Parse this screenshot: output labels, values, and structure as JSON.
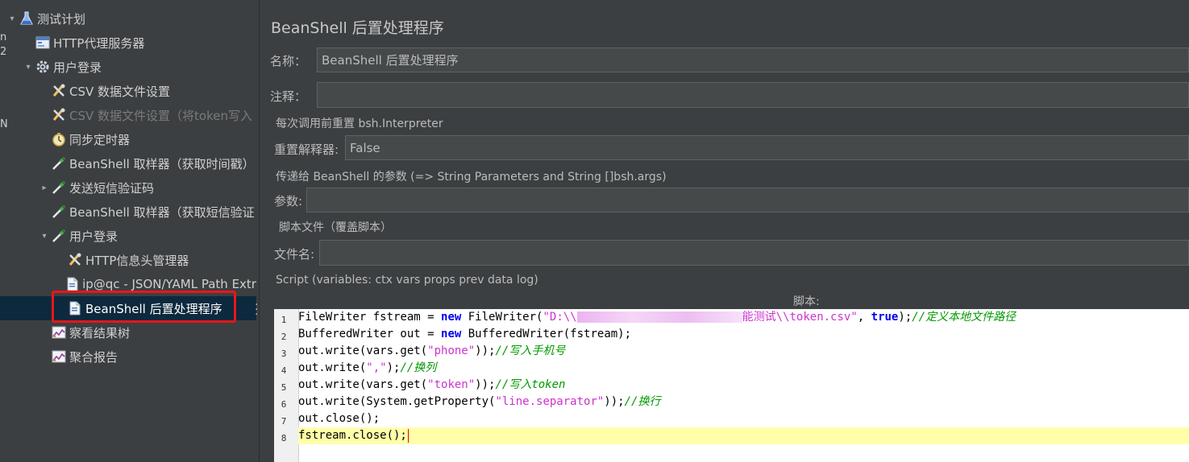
{
  "tree": {
    "items": [
      {
        "label": "测试计划",
        "icon": "flask-icon",
        "depth": 0,
        "expander": "expanded"
      },
      {
        "label": "HTTP代理服务器",
        "icon": "proxy-server-icon",
        "depth": 1,
        "expander": "none"
      },
      {
        "label": "用户登录",
        "icon": "gear-icon",
        "depth": 1,
        "expander": "expanded"
      },
      {
        "label": "CSV 数据文件设置",
        "icon": "tools-icon",
        "depth": 2,
        "expander": "none"
      },
      {
        "label": "CSV 数据文件设置（将token写入",
        "icon": "tools-icon",
        "depth": 2,
        "expander": "none",
        "disabled": true
      },
      {
        "label": "同步定时器",
        "icon": "timer-icon",
        "depth": 2,
        "expander": "none"
      },
      {
        "label": "BeanShell 取样器（获取时间戳）",
        "icon": "pipette-icon",
        "depth": 2,
        "expander": "none"
      },
      {
        "label": "发送短信验证码",
        "icon": "pipette-icon",
        "depth": 2,
        "expander": "collapsed"
      },
      {
        "label": "BeanShell 取样器（获取短信验证",
        "icon": "pipette-icon",
        "depth": 2,
        "expander": "none"
      },
      {
        "label": "用户登录",
        "icon": "pipette-icon",
        "depth": 2,
        "expander": "expanded"
      },
      {
        "label": "HTTP信息头管理器",
        "icon": "tools-icon",
        "depth": 3,
        "expander": "none"
      },
      {
        "label": "ip@qc - JSON/YAML Path Extr",
        "icon": "document-icon",
        "depth": 3,
        "expander": "none"
      },
      {
        "label": "BeanShell 后置处理程序",
        "icon": "document-icon",
        "depth": 3,
        "expander": "none",
        "selected": true
      },
      {
        "label": "察看结果树",
        "icon": "graph-icon",
        "depth": 2,
        "expander": "none"
      },
      {
        "label": "聚合报告",
        "icon": "graph-icon",
        "depth": 2,
        "expander": "none"
      }
    ],
    "edge_glyphs": [
      "n",
      "2",
      "",
      "",
      "",
      "",
      "N"
    ]
  },
  "panel": {
    "title": "BeanShell 后置处理程序",
    "name_label": "名称：",
    "name_value": "BeanShell 后置处理程序",
    "comment_label": "注释：",
    "comment_value": "",
    "reset_group": "每次调用前重置 bsh.Interpreter",
    "reset_label": "重置解释器:",
    "reset_value": "False",
    "params_group": "传递给 BeanShell 的参数 (=> String Parameters and String []bsh.args)",
    "params_label": "参数:",
    "params_value": "",
    "file_group": "脚本文件（覆盖脚本）",
    "file_label": "文件名:",
    "file_value": "",
    "script_group": "Script (variables: ctx vars props prev data log)",
    "script_label": "脚本:"
  },
  "editor": {
    "line_numbers": [
      "1",
      "2",
      "3",
      "4",
      "5",
      "6",
      "7",
      "8"
    ],
    "current_line": 8,
    "lines": [
      [
        {
          "t": "FileWriter",
          "c": "t-black"
        },
        {
          "t": " fstream = ",
          "c": "t-black"
        },
        {
          "t": "new",
          "c": "t-blue"
        },
        {
          "t": " FileWriter(",
          "c": "t-black"
        },
        {
          "t": "\"D:\\\\",
          "c": "t-str"
        },
        {
          "t": "",
          "c": "redact"
        },
        {
          "t": "能测试\\\\token.csv\"",
          "c": "t-str"
        },
        {
          "t": ", ",
          "c": "t-black"
        },
        {
          "t": "true",
          "c": "t-blue"
        },
        {
          "t": ");",
          "c": "t-black"
        },
        {
          "t": "//定义本地文件路径",
          "c": "t-com"
        }
      ],
      [
        {
          "t": "BufferedWriter out = ",
          "c": "t-black"
        },
        {
          "t": "new",
          "c": "t-blue"
        },
        {
          "t": " BufferedWriter(fstream);",
          "c": "t-black"
        }
      ],
      [
        {
          "t": "out.write(vars.get(",
          "c": "t-black"
        },
        {
          "t": "\"phone\"",
          "c": "t-str"
        },
        {
          "t": "));",
          "c": "t-black"
        },
        {
          "t": "//写入手机号",
          "c": "t-com"
        }
      ],
      [
        {
          "t": "out.write(",
          "c": "t-black"
        },
        {
          "t": "\",\"",
          "c": "t-str"
        },
        {
          "t": ");",
          "c": "t-black"
        },
        {
          "t": "//换列",
          "c": "t-com"
        }
      ],
      [
        {
          "t": "out.write(vars.get(",
          "c": "t-black"
        },
        {
          "t": "\"token\"",
          "c": "t-str"
        },
        {
          "t": "));",
          "c": "t-black"
        },
        {
          "t": "//写入token",
          "c": "t-com"
        }
      ],
      [
        {
          "t": "out.write(System.getProperty(",
          "c": "t-black"
        },
        {
          "t": "\"line.separator\"",
          "c": "t-str"
        },
        {
          "t": "));",
          "c": "t-black"
        },
        {
          "t": "//换行",
          "c": "t-com"
        }
      ],
      [
        {
          "t": "out.close();",
          "c": "t-black"
        }
      ],
      [
        {
          "t": "fstream.close();",
          "c": "t-black"
        }
      ]
    ]
  },
  "colors": {
    "selection_outline": "#e8161b",
    "selected_row": "#0d293e",
    "current_line": "#ffffaa"
  }
}
